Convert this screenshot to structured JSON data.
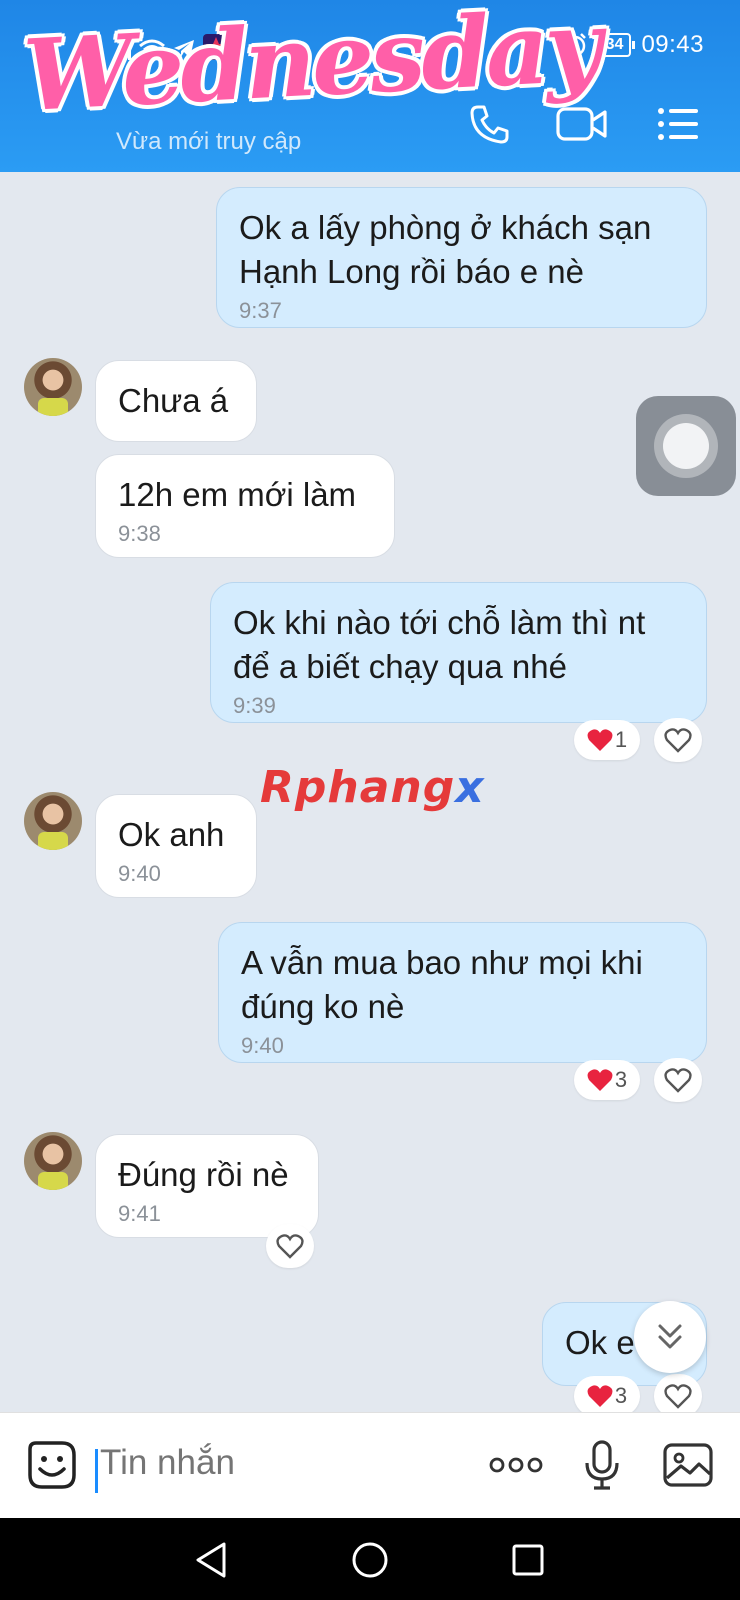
{
  "status_bar": {
    "time": "09:43",
    "battery": "34"
  },
  "header": {
    "contact_name": "Wednesday",
    "contact_status": "Vừa mới truy cập"
  },
  "messages": [
    {
      "from": "me",
      "lines": [
        "Ok a lấy phòng ở khách sạn",
        "Hạnh Long rồi báo e nè"
      ],
      "time": "9:37"
    },
    {
      "from": "them",
      "text": "Chưa á"
    },
    {
      "from": "them",
      "text": "12h em mới làm",
      "time": "9:38"
    },
    {
      "from": "me",
      "lines": [
        "Ok khi nào tới chỗ làm thì nt",
        "để a biết chạy qua nhé"
      ],
      "time": "9:39",
      "reaction_count": "1"
    },
    {
      "from": "them",
      "text": "Ok anh",
      "time": "9:40"
    },
    {
      "from": "me",
      "lines": [
        "A vẫn mua bao như mọi khi",
        "đúng ko nè"
      ],
      "time": "9:40",
      "reaction_count": "3"
    },
    {
      "from": "them",
      "text": "Đúng rồi nè",
      "time": "9:41"
    },
    {
      "from": "me",
      "text": "Ok e",
      "reaction_count": "3"
    }
  ],
  "watermark": {
    "part_a": "Rphang",
    "part_b": "x"
  },
  "composer": {
    "placeholder": "Tin nhắn"
  },
  "colors": {
    "header": "#2b9cf4",
    "outgoing_bubble": "#d4ecfe",
    "incoming_bubble": "#ffffff",
    "background": "#e3e8ef",
    "heart": "#e8233f"
  },
  "icons": [
    "phone-icon",
    "video-call-icon",
    "menu-list-icon",
    "sticker-icon",
    "more-icon",
    "microphone-icon",
    "image-icon",
    "back-nav-icon",
    "home-nav-icon",
    "recents-nav-icon",
    "heart-icon",
    "chevron-double-down-icon"
  ]
}
